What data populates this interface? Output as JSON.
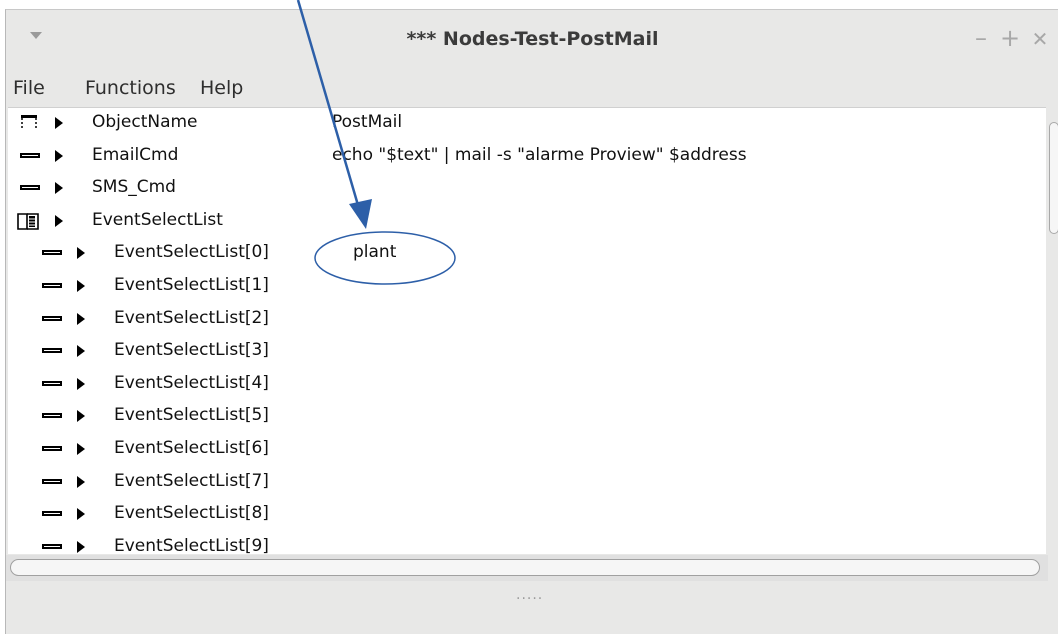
{
  "window": {
    "title": "*** Nodes-Test-PostMail",
    "controls": {
      "minimize": "–",
      "maximize": "+",
      "close": "✕"
    }
  },
  "menu": [
    "File",
    "Functions",
    "Help"
  ],
  "rows": [
    {
      "icon": "struct-icon",
      "name": "ObjectName",
      "value": "PostMail"
    },
    {
      "icon": "attribute-icon",
      "name": "EmailCmd",
      "value": "echo \"$text\" | mail -s \"alarme Proview\" $address"
    },
    {
      "icon": "attribute-icon",
      "name": "SMS_Cmd",
      "value": ""
    },
    {
      "icon": "array-icon",
      "name": "EventSelectList",
      "value": ""
    },
    {
      "icon": "attribute-icon",
      "name": "EventSelectList[0]",
      "value": "plant"
    },
    {
      "icon": "attribute-icon",
      "name": "EventSelectList[1]",
      "value": ""
    },
    {
      "icon": "attribute-icon",
      "name": "EventSelectList[2]",
      "value": ""
    },
    {
      "icon": "attribute-icon",
      "name": "EventSelectList[3]",
      "value": ""
    },
    {
      "icon": "attribute-icon",
      "name": "EventSelectList[4]",
      "value": ""
    },
    {
      "icon": "attribute-icon",
      "name": "EventSelectList[5]",
      "value": ""
    },
    {
      "icon": "attribute-icon",
      "name": "EventSelectList[6]",
      "value": ""
    },
    {
      "icon": "attribute-icon",
      "name": "EventSelectList[7]",
      "value": ""
    },
    {
      "icon": "attribute-icon",
      "name": "EventSelectList[8]",
      "value": ""
    },
    {
      "icon": "attribute-icon",
      "name": "EventSelectList[9]",
      "value": ""
    }
  ],
  "statusbar": {
    "grip": "....."
  },
  "colors": {
    "annotation": "#2d5fa8",
    "window_bg": "#e8e8e7"
  }
}
